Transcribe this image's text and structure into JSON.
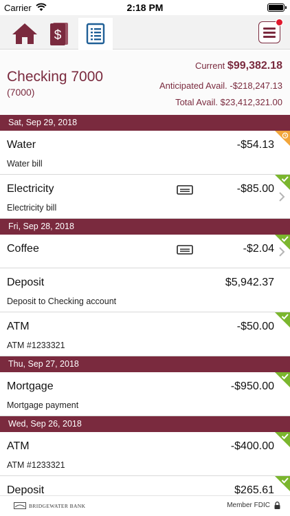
{
  "status_bar": {
    "carrier": "Carrier",
    "time": "2:18 PM"
  },
  "nav": {
    "tabs": [
      {
        "icon": "home-icon",
        "active": false
      },
      {
        "icon": "bills-dollar-icon",
        "active": false
      },
      {
        "icon": "register-list-icon",
        "active": true
      }
    ],
    "menu_icon": "hamburger-menu-icon",
    "has_notification": true
  },
  "account": {
    "name": "Checking 7000",
    "number": "(7000)",
    "current_label": "Current",
    "current_amount": "$99,382.18",
    "anticipated_label": "Anticipated Avail.",
    "anticipated_amount": "-$218,247.13",
    "total_label": "Total Avail.",
    "total_amount": "$23,412,321.00"
  },
  "groups": [
    {
      "date": "Sat, Sep 29, 2018",
      "transactions": [
        {
          "title": "Water",
          "amount": "-$54.13",
          "description": "Water bill",
          "status": "pending"
        },
        {
          "title": "Electricity",
          "amount": "-$85.00",
          "description": "Electricity bill",
          "status": "cleared",
          "memo": true,
          "chevron": true
        }
      ]
    },
    {
      "date": "Fri, Sep 28, 2018",
      "transactions": [
        {
          "title": "Coffee",
          "amount": "-$2.04",
          "description": "",
          "status": "cleared",
          "memo": true,
          "chevron": true
        },
        {
          "title": "Deposit",
          "amount": "$5,942.37",
          "description": "Deposit to Checking account",
          "status": "cleared"
        },
        {
          "title": "ATM",
          "amount": "-$50.00",
          "description": "ATM #1233321",
          "status": "cleared"
        }
      ]
    },
    {
      "date": "Thu, Sep 27, 2018",
      "transactions": [
        {
          "title": "Mortgage",
          "amount": "-$950.00",
          "description": "Mortgage payment",
          "status": "cleared"
        }
      ]
    },
    {
      "date": "Wed, Sep 26, 2018",
      "transactions": [
        {
          "title": "ATM",
          "amount": "-$400.00",
          "description": "ATM #1233321",
          "status": "cleared"
        },
        {
          "title": "Deposit",
          "amount": "$265.61",
          "description": "",
          "status": "cleared"
        }
      ]
    }
  ],
  "footer": {
    "brand": "BRIDGEWATER BANK",
    "fdic": "Member FDIC"
  },
  "colors": {
    "brand": "#7a2a3e",
    "cleared": "#7bb62e",
    "pending": "#f2a53a",
    "notification": "#e0182d"
  }
}
